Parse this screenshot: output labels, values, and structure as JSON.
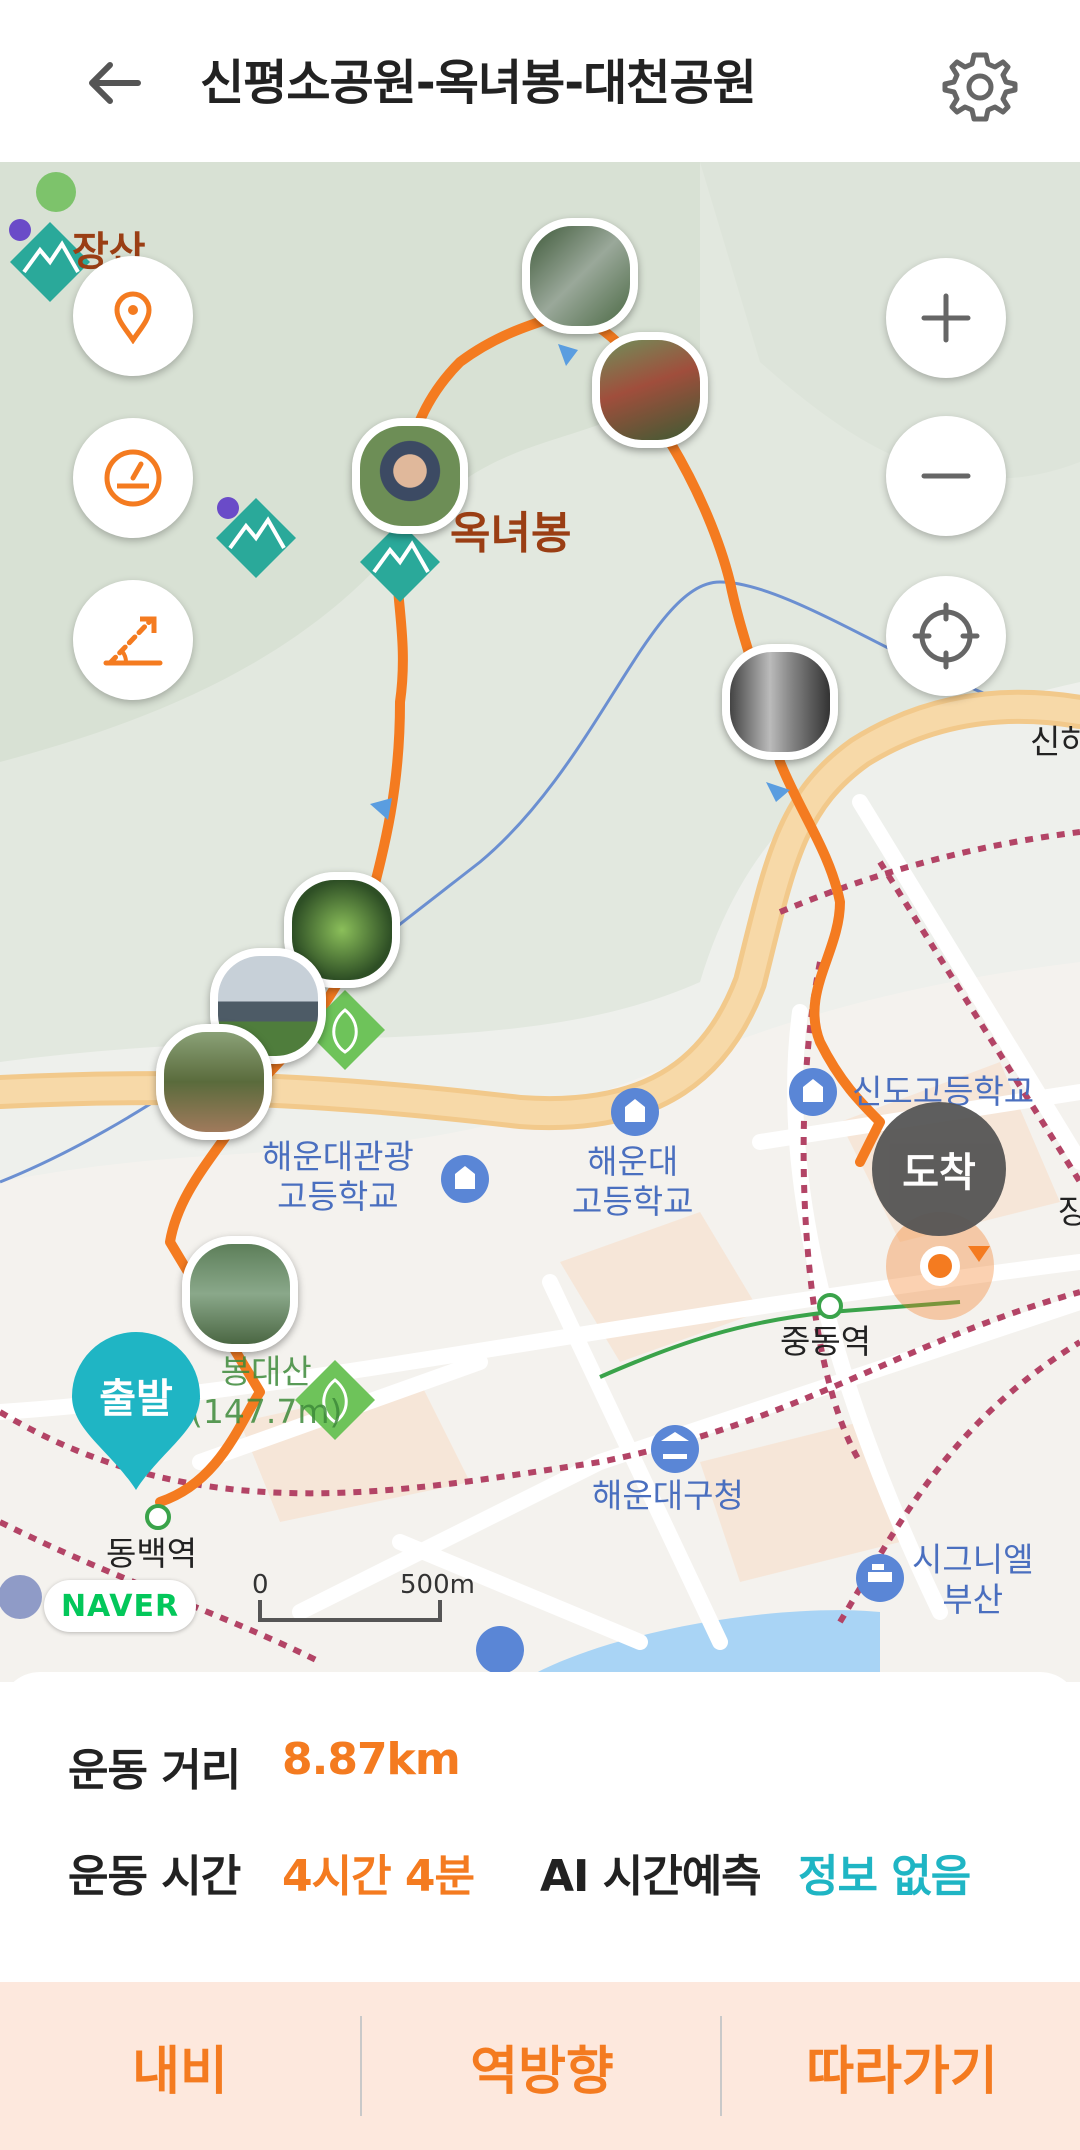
{
  "header": {
    "title": "신평소공원-옥녀봉-대천공원",
    "back_icon": "arrow-left-icon",
    "settings_icon": "gear-icon"
  },
  "map": {
    "labels": {
      "peak_okneobong": "옥녀봉",
      "mountain_top_left": "장산",
      "school_haeundae_tourism_1": "해운대관광",
      "school_haeundae_tourism_2": "고등학교",
      "school_haeundae_1": "해운대",
      "school_haeundae_2": "고등학교",
      "school_sindo": "신도고등학교",
      "station_jungdong": "중동역",
      "station_dongbaek": "동백역",
      "district_office": "해운대구청",
      "hotel_1": "시그니엘",
      "hotel_2": "부산",
      "mountain_bongdae_1": "봉대산",
      "mountain_bongdae_2": "(147.7m)",
      "right_edge_1": "신하",
      "right_edge_2": "장"
    },
    "start_marker": "출발",
    "end_marker": "도착",
    "naver_logo": "NAVER",
    "scale": {
      "zero": "0",
      "distance": "500m"
    },
    "controls": {
      "location_pin": "location-pin-icon",
      "speedometer": "speedometer-icon",
      "slope": "slope-icon",
      "zoom_in": "plus-icon",
      "zoom_out": "minus-icon",
      "my_location": "crosshair-icon"
    },
    "route_color": "#f47b20",
    "start_color": "#1fb5c4",
    "end_color": "#555555"
  },
  "stats": {
    "distance_label": "운동 거리",
    "distance_value": "8.87km",
    "time_label": "운동 시간",
    "time_value": "4시간 4분",
    "ai_label": "AI 시간예측",
    "ai_value": "정보 없음",
    "value_color": "#f47b20",
    "ai_value_color": "#1fb5c4"
  },
  "actions": {
    "navi": "내비",
    "reverse": "역방향",
    "follow": "따라가기"
  }
}
